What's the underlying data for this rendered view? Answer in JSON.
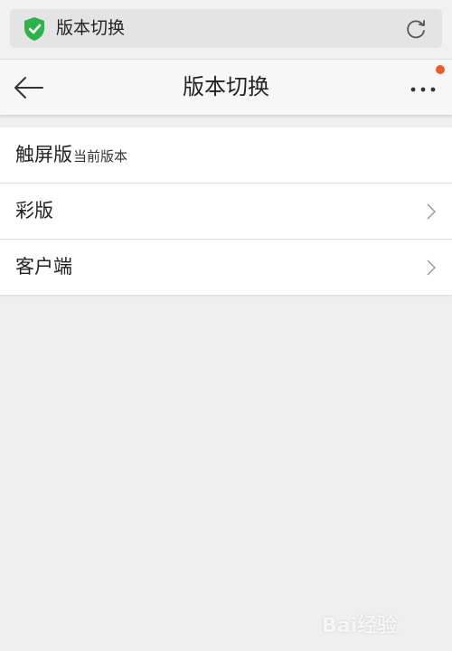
{
  "browser": {
    "address_title": "版本切换",
    "icons": {
      "secure": "shield-check-icon",
      "reload": "reload-icon"
    },
    "colors": {
      "shield": "#2db34a"
    }
  },
  "header": {
    "title": "版本切换",
    "icons": {
      "back": "arrow-left-icon",
      "more": "more-dots-icon"
    },
    "notification_dot_color": "#f05a28"
  },
  "versions": {
    "items": [
      {
        "label": "触屏版",
        "sub": "当前版本"
      },
      {
        "label": "彩版"
      },
      {
        "label": "客户端"
      }
    ]
  },
  "watermark": {
    "text": "Bai经验"
  }
}
